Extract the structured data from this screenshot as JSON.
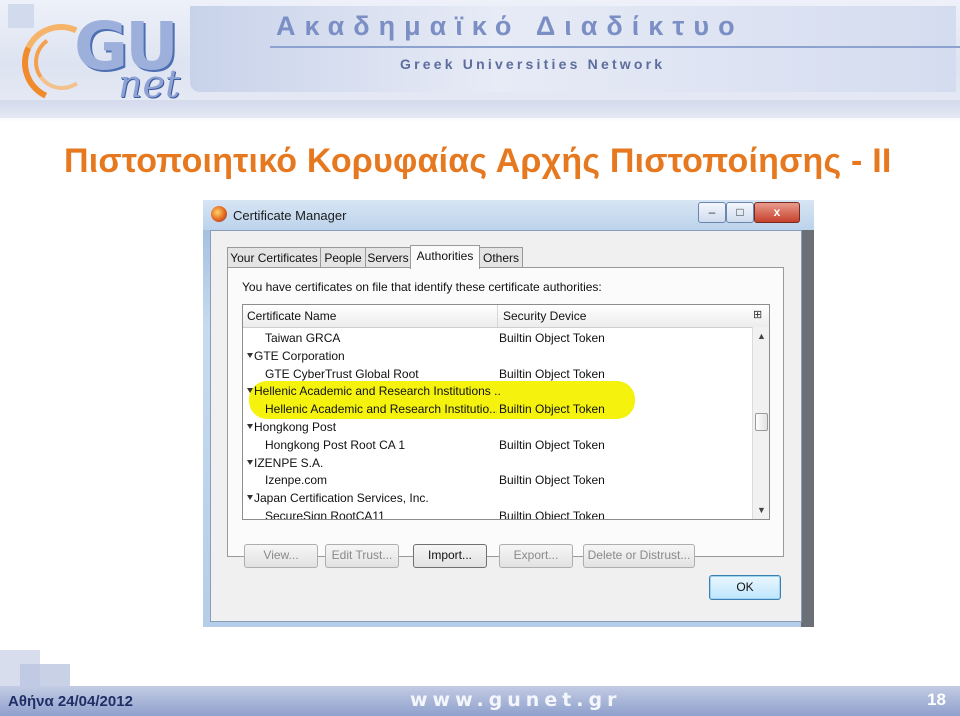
{
  "banner": {
    "logo_text_top": "GU",
    "logo_text_bottom": "net",
    "title_greek": "Ακαδημαϊκό Διαδίκτυο",
    "subtitle": "Greek Universities Network"
  },
  "slide": {
    "title": "Πιστοποιητικό Κορυφαίας Αρχής Πιστοποίησης - II"
  },
  "dialog": {
    "window_title": "Certificate Manager",
    "window_buttons": {
      "minimize": "–",
      "maximize": "□",
      "close": "x"
    },
    "tabs": [
      {
        "label": "Your Certificates",
        "active": false
      },
      {
        "label": "People",
        "active": false
      },
      {
        "label": "Servers",
        "active": false
      },
      {
        "label": "Authorities",
        "active": true
      },
      {
        "label": "Others",
        "active": false
      }
    ],
    "description": "You have certificates on file that identify these certificate authorities:",
    "columns": {
      "name": "Certificate Name",
      "device": "Security Device"
    },
    "rows": [
      {
        "name": "Taiwan GRCA",
        "device": "Builtin Object Token",
        "group": false
      },
      {
        "name": "GTE Corporation",
        "device": "",
        "group": true
      },
      {
        "name": "GTE CyberTrust Global Root",
        "device": "Builtin Object Token",
        "group": false
      },
      {
        "name": "Hellenic Academic and Research Institutions ...",
        "device": "",
        "group": true,
        "highlighted": true
      },
      {
        "name": "Hellenic Academic and Research Institutio...",
        "device": "Builtin Object Token",
        "group": false,
        "highlighted": true
      },
      {
        "name": "Hongkong Post",
        "device": "",
        "group": true
      },
      {
        "name": "Hongkong Post Root CA 1",
        "device": "Builtin Object Token",
        "group": false
      },
      {
        "name": "IZENPE S.A.",
        "device": "",
        "group": true
      },
      {
        "name": "Izenpe.com",
        "device": "Builtin Object Token",
        "group": false
      },
      {
        "name": "Japan Certification Services, Inc.",
        "device": "",
        "group": true
      },
      {
        "name": "SecureSign RootCA11",
        "device": "Builtin Object Token",
        "group": false
      }
    ],
    "buttons": {
      "view": "View...",
      "edit_trust": "Edit Trust...",
      "import": "Import...",
      "export": "Export...",
      "delete": "Delete or Distrust...",
      "ok": "OK"
    },
    "highlight_color": "#f4f200"
  },
  "footer": {
    "date": "Αθήνα 24/04/2012",
    "url": "www.gunet.gr",
    "page_number": "18"
  },
  "colors": {
    "title": "#e6791f",
    "banner_text": "#7b8fc4",
    "footer_bar": "#8ea0cc"
  }
}
